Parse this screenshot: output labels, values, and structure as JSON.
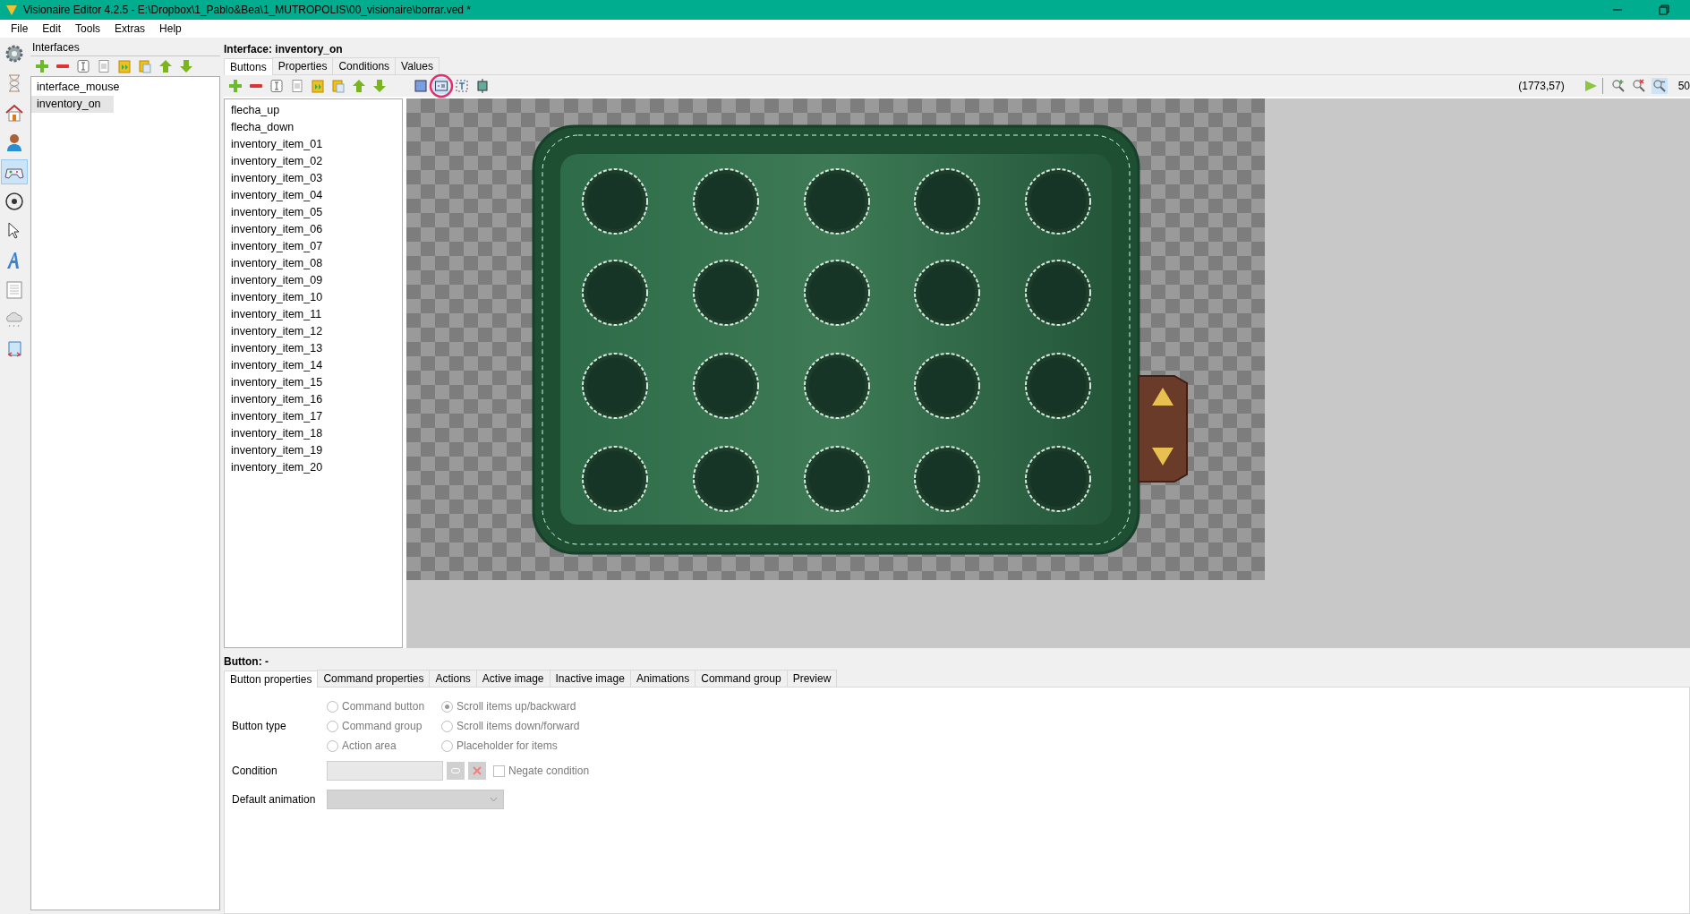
{
  "window": {
    "title": "Visionaire Editor 4.2.5 - E:\\Dropbox\\1_Pablo&Bea\\1_MUTROPOLIS\\00_visionaire\\borrar.ved *"
  },
  "menu": [
    "File",
    "Edit",
    "Tools",
    "Extras",
    "Help"
  ],
  "sidebar": {
    "items": [
      {
        "selected": false
      },
      {
        "selected": false
      },
      {
        "selected": false
      },
      {
        "selected": false
      },
      {
        "selected": true
      },
      {
        "selected": false
      },
      {
        "selected": false
      },
      {
        "selected": false
      },
      {
        "selected": false
      },
      {
        "selected": false
      },
      {
        "selected": false
      }
    ]
  },
  "interfaces": {
    "title": "Interfaces",
    "items": [
      {
        "label": "interface_mouse",
        "selected": false
      },
      {
        "label": "inventory_on",
        "selected": true
      }
    ]
  },
  "interface": {
    "title": "Interface: inventory_on",
    "tabs": [
      {
        "label": "Buttons",
        "selected": true
      },
      {
        "label": "Properties",
        "selected": false
      },
      {
        "label": "Conditions",
        "selected": false
      },
      {
        "label": "Values",
        "selected": false
      }
    ],
    "canvas_tools": [
      {
        "selected": false
      },
      {
        "selected": true
      },
      {
        "selected": false
      },
      {
        "selected": false
      }
    ],
    "coordinates": "(1773,57)",
    "zoom": "50",
    "zoom_tools": [
      {
        "selected": false
      },
      {
        "selected": false
      },
      {
        "selected": true
      }
    ],
    "buttons": [
      "flecha_up",
      "flecha_down",
      "inventory_item_01",
      "inventory_item_02",
      "inventory_item_03",
      "inventory_item_04",
      "inventory_item_05",
      "inventory_item_06",
      "inventory_item_07",
      "inventory_item_08",
      "inventory_item_09",
      "inventory_item_10",
      "inventory_item_11",
      "inventory_item_12",
      "inventory_item_13",
      "inventory_item_14",
      "inventory_item_15",
      "inventory_item_16",
      "inventory_item_17",
      "inventory_item_18",
      "inventory_item_19",
      "inventory_item_20"
    ]
  },
  "button_panel": {
    "title": "Button: -",
    "tabs": [
      {
        "label": "Button properties",
        "selected": true
      },
      {
        "label": "Command properties",
        "selected": false
      },
      {
        "label": "Actions",
        "selected": false
      },
      {
        "label": "Active image",
        "selected": false
      },
      {
        "label": "Inactive image",
        "selected": false
      },
      {
        "label": "Animations",
        "selected": false
      },
      {
        "label": "Command group",
        "selected": false
      },
      {
        "label": "Preview",
        "selected": false
      }
    ],
    "button_type_label": "Button type",
    "button_types": [
      {
        "label": "Command button",
        "selected": false
      },
      {
        "label": "Scroll items up/backward",
        "selected": true
      },
      {
        "label": "Command group",
        "selected": false
      },
      {
        "label": "Scroll items down/forward",
        "selected": false
      },
      {
        "label": "Action area",
        "selected": false
      },
      {
        "label": "Placeholder for items",
        "selected": false
      }
    ],
    "condition_label": "Condition",
    "negate": {
      "label": "Negate condition",
      "checked": false
    },
    "default_animation_label": "Default animation"
  }
}
